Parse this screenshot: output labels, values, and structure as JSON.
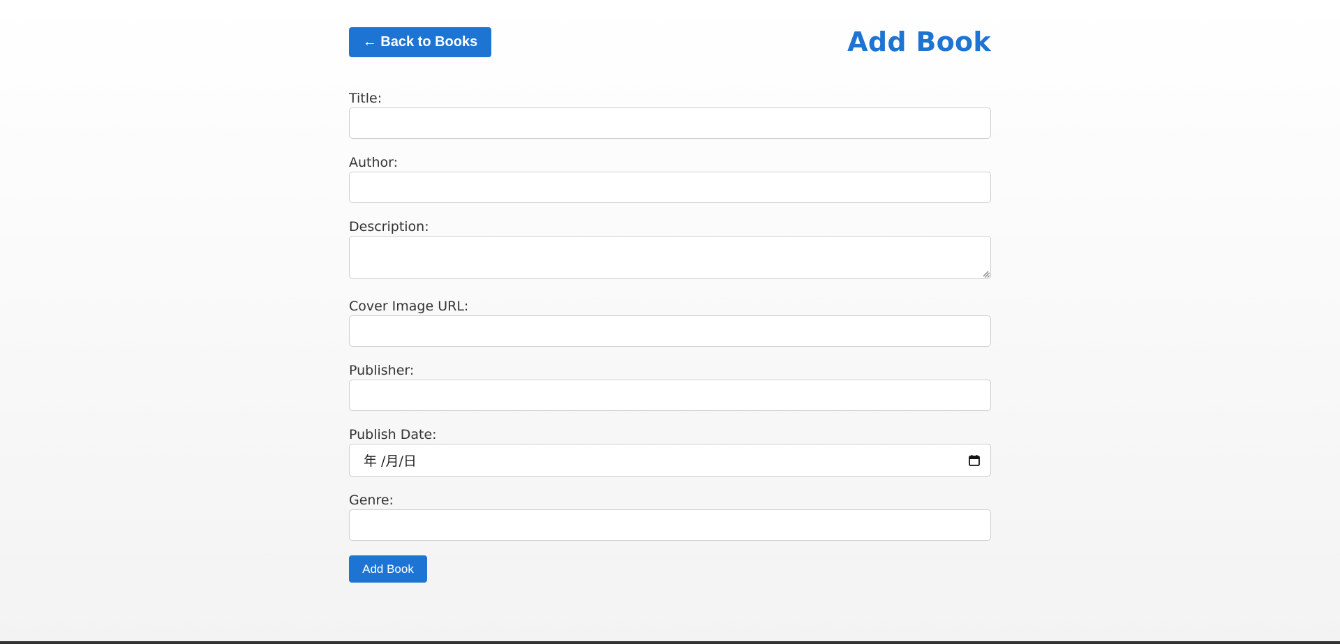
{
  "header": {
    "back_label": "← Back to Books",
    "title": "Add Book"
  },
  "form": {
    "title_label": "Title:",
    "title_value": "",
    "author_label": "Author:",
    "author_value": "",
    "description_label": "Description:",
    "description_value": "",
    "cover_label": "Cover Image URL:",
    "cover_value": "",
    "publisher_label": "Publisher:",
    "publisher_value": "",
    "publish_date_label": "Publish Date:",
    "publish_date_placeholder": "年 /月/日",
    "genre_label": "Genre:",
    "genre_value": "",
    "submit_label": "Add Book"
  },
  "colors": {
    "accent": "#1e74d2",
    "text": "#333333",
    "border": "#cfcfcf"
  },
  "icons": {
    "calendar": "calendar-icon",
    "resize": "resize-grip-icon"
  }
}
